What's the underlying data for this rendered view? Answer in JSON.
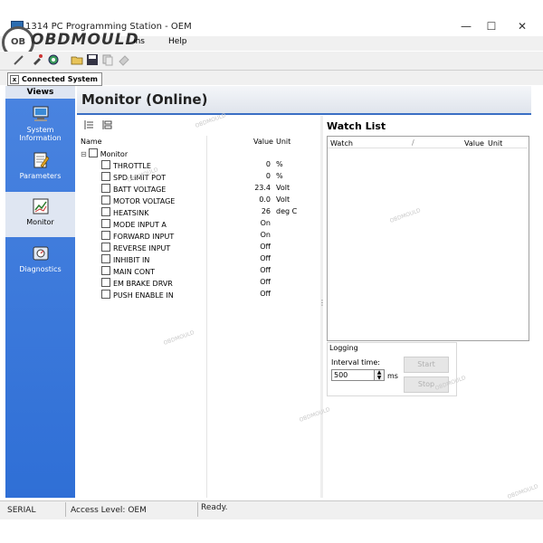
{
  "window": {
    "title": "1314 PC Programming Station - OEM",
    "minimize": "—",
    "maximize": "☐",
    "close": "✕"
  },
  "logo": {
    "text": "OBDMOULD",
    "badge": "OB"
  },
  "menu": {
    "items": [
      "Options",
      "Help"
    ]
  },
  "toolbar": {
    "icons": [
      "wand-icon",
      "probe-icon",
      "settings-icon",
      "folder-open-icon",
      "save-icon",
      "copy-icon",
      "eraser-icon"
    ]
  },
  "tabs": {
    "connected": "Connected System",
    "close_glyph": "x"
  },
  "sidebar": {
    "header": "Views",
    "items": [
      {
        "label": "System Information",
        "icon": "computer-icon"
      },
      {
        "label": "Parameters",
        "icon": "notepad-pencil-icon"
      },
      {
        "label": "Monitor",
        "icon": "chart-icon",
        "active": true
      },
      {
        "label": "Diagnostics",
        "icon": "diagnostics-icon"
      }
    ]
  },
  "main": {
    "title": "Monitor (Online)"
  },
  "monitor": {
    "columns": {
      "name": "Name",
      "value": "Value",
      "unit": "Unit"
    },
    "root": {
      "label": "Monitor",
      "expander": "⊟"
    },
    "rows": [
      {
        "name": "THROTTLE",
        "value": "0",
        "unit": "%"
      },
      {
        "name": "SPD LIMIT POT",
        "value": "0",
        "unit": "%"
      },
      {
        "name": "BATT VOLTAGE",
        "value": "23.4",
        "unit": "Volt"
      },
      {
        "name": "MOTOR VOLTAGE",
        "value": "0.0",
        "unit": "Volt"
      },
      {
        "name": "HEATSINK",
        "value": "26",
        "unit": "deg C"
      },
      {
        "name": "MODE INPUT A",
        "value": "On",
        "unit": ""
      },
      {
        "name": "FORWARD INPUT",
        "value": "On",
        "unit": ""
      },
      {
        "name": "REVERSE INPUT",
        "value": "Off",
        "unit": ""
      },
      {
        "name": "INHIBIT IN",
        "value": "Off",
        "unit": ""
      },
      {
        "name": "MAIN CONT",
        "value": "Off",
        "unit": ""
      },
      {
        "name": "EM BRAKE DRVR",
        "value": "Off",
        "unit": ""
      },
      {
        "name": "PUSH ENABLE IN",
        "value": "Off",
        "unit": ""
      }
    ]
  },
  "watch": {
    "title": "Watch List",
    "columns": {
      "watch": "Watch",
      "value": "Value",
      "unit": "Unit"
    }
  },
  "logging": {
    "group_label": "Logging",
    "interval_label": "Interval time:",
    "interval_value": "500",
    "interval_unit": "ms",
    "start_label": "Start",
    "stop_label": "Stop"
  },
  "status": {
    "port": "SERIAL",
    "access": "Access Level: OEM",
    "state": "Ready."
  },
  "watermark": "OBDMOULD",
  "colors": {
    "sidebar": "#2f6fd6",
    "header_rule": "#3a6fc4"
  }
}
